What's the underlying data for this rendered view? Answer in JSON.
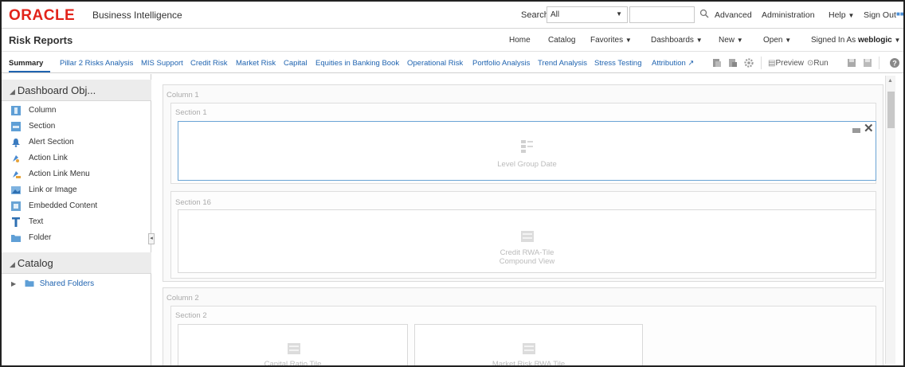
{
  "brand": {
    "logo_text": "ORACLE",
    "product": "Business Intelligence",
    "logo_color": "#e2231a"
  },
  "header": {
    "search_label": "Search",
    "search_scope": "All",
    "search_value": "",
    "links": {
      "advanced": "Advanced",
      "administration": "Administration",
      "help": "Help",
      "sign_out": "Sign Out"
    }
  },
  "titlebar": {
    "title": "Risk Reports",
    "nav": {
      "home": "Home",
      "catalog": "Catalog",
      "favorites": "Favorites",
      "dashboards": "Dashboards",
      "new": "New",
      "open": "Open",
      "signed_in_as": "Signed In As",
      "user": "weblogic"
    }
  },
  "tabs": [
    "Summary",
    "Pillar 2 Risks Analysis",
    "MIS Support",
    "Credit Risk",
    "Market Risk",
    "Capital",
    "Equities in Banking Book",
    "Operational Risk",
    "Portfolio Analysis",
    "Trend Analysis",
    "Stress Testing",
    "Attribution"
  ],
  "toolbar": {
    "preview": "Preview",
    "run": "Run"
  },
  "left_panel": {
    "dashboard_objects_title": "Dashboard Obj...",
    "objects": [
      {
        "label": "Column",
        "icon": "column-icon"
      },
      {
        "label": "Section",
        "icon": "section-icon"
      },
      {
        "label": "Alert Section",
        "icon": "alert-icon"
      },
      {
        "label": "Action Link",
        "icon": "action-link-icon"
      },
      {
        "label": "Action Link Menu",
        "icon": "action-link-menu-icon"
      },
      {
        "label": "Link or Image",
        "icon": "image-icon"
      },
      {
        "label": "Embedded Content",
        "icon": "embedded-icon"
      },
      {
        "label": "Text",
        "icon": "text-icon"
      },
      {
        "label": "Folder",
        "icon": "folder-icon"
      }
    ],
    "catalog_title": "Catalog",
    "catalog_items": [
      "Shared Folders"
    ]
  },
  "canvas": {
    "column1": {
      "label": "Column 1",
      "section1": {
        "label": "Section 1",
        "content": "Level Group Date"
      },
      "section16": {
        "label": "Section 16",
        "content_line1": "Credit RWA-Tile",
        "content_line2": "Compound View"
      }
    },
    "column2": {
      "label": "Column 2",
      "section2": {
        "label": "Section 2",
        "content_left": "Capital Ratio Tile",
        "content_right": "Market Risk RWA Tile"
      }
    }
  },
  "colors": {
    "link": "#2064b0",
    "selected_border": "#6aa4d5"
  }
}
